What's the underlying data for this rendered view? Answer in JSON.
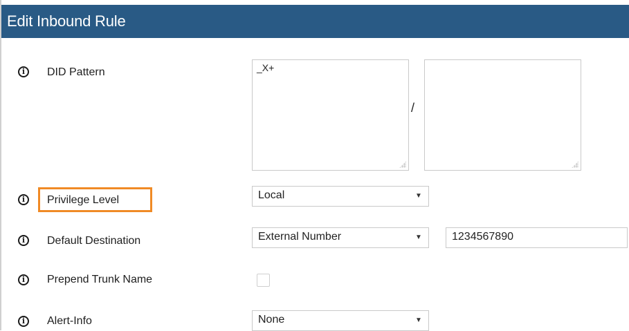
{
  "header": {
    "title": "Edit Inbound Rule"
  },
  "fields": {
    "did_pattern": {
      "label": "DID Pattern",
      "value": "_X+",
      "value2": "",
      "separator": "/"
    },
    "privilege_level": {
      "label": "Privilege Level",
      "value": "Local"
    },
    "default_destination": {
      "label": "Default Destination",
      "value": "External Number",
      "number": "1234567890"
    },
    "prepend_trunk_name": {
      "label": "Prepend Trunk Name",
      "checked": false
    },
    "alert_info": {
      "label": "Alert-Info",
      "value": "None"
    }
  },
  "icons": {
    "info": "i",
    "dropdown_arrow": "▼"
  },
  "colors": {
    "header_bg": "#295a85",
    "highlight": "#f08a25"
  }
}
